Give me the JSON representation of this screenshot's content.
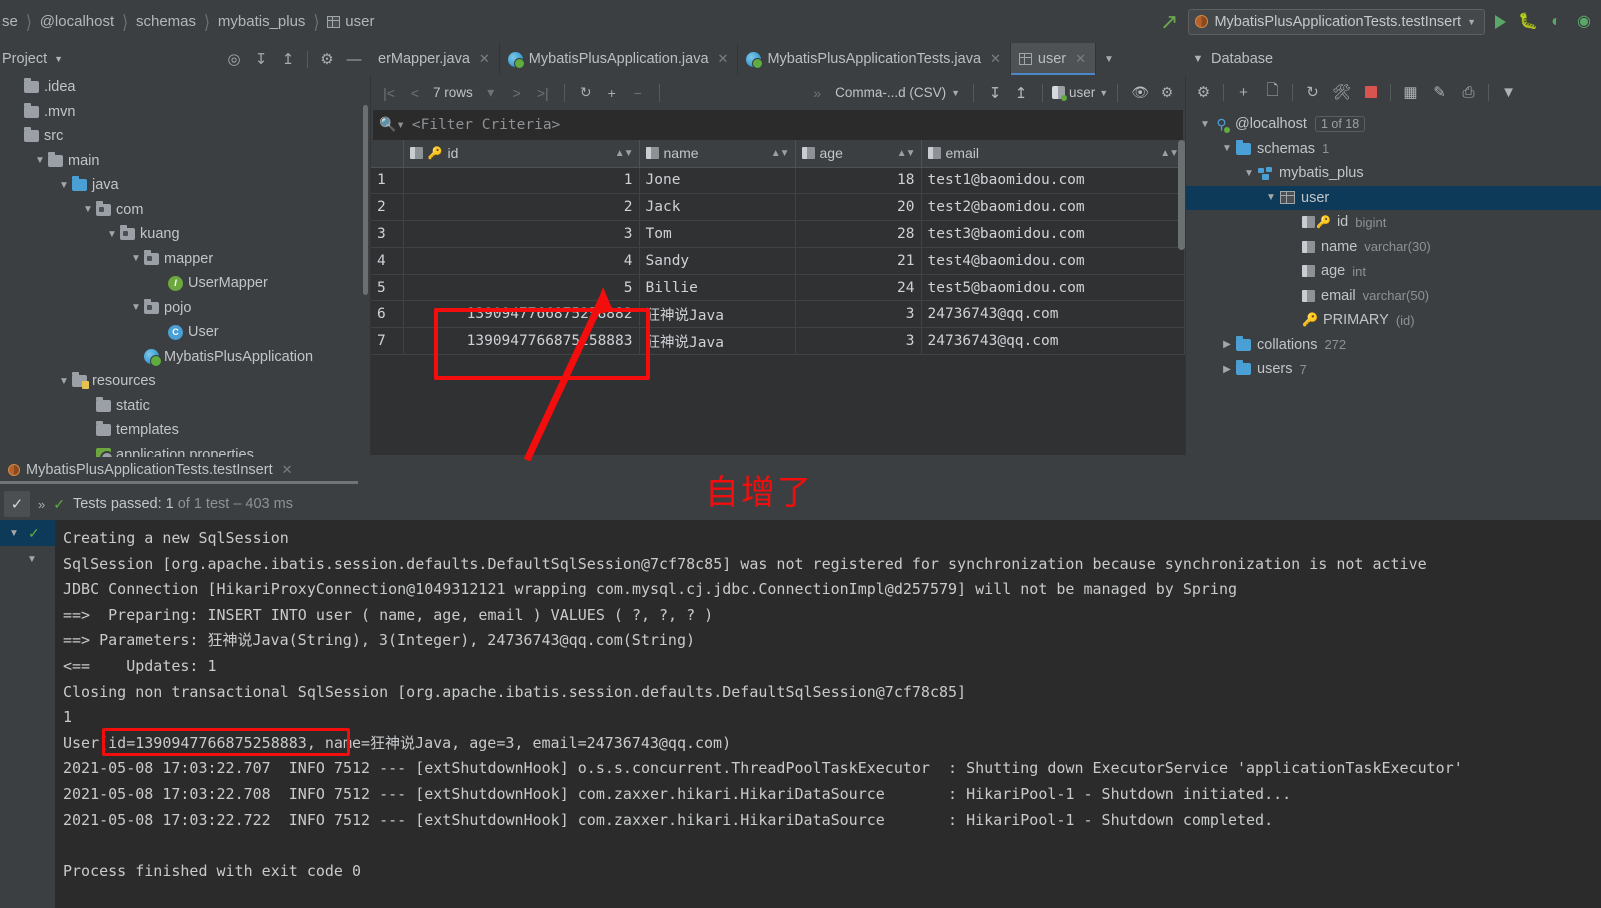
{
  "breadcrumb": {
    "items": [
      "@localhost",
      "schemas",
      "mybatis_plus",
      "user"
    ],
    "first_partial": "se"
  },
  "toolbar": {
    "run_config": "MybatisPlusApplicationTests.testInsert",
    "run_label": "Run",
    "debug_label": "Debug",
    "coverage_label": "Run with Coverage"
  },
  "project_tool": {
    "title": "Project"
  },
  "editor_tabs": [
    {
      "label": "erMapper.java",
      "icon": "java-file-icon",
      "active": false
    },
    {
      "label": "MybatisPlusApplication.java",
      "icon": "spring-boot-icon",
      "active": false
    },
    {
      "label": "MybatisPlusApplicationTests.java",
      "icon": "spring-boot-icon",
      "active": false
    },
    {
      "label": "user",
      "icon": "table-icon",
      "active": true
    }
  ],
  "project_tree": [
    {
      "label": ".idea",
      "indent": 0,
      "chevron": "",
      "icon": "folder"
    },
    {
      "label": ".mvn",
      "indent": 0,
      "chevron": "",
      "icon": "folder"
    },
    {
      "label": "src",
      "indent": 0,
      "chevron": "",
      "icon": "folder"
    },
    {
      "label": "main",
      "indent": 1,
      "chevron": "v",
      "icon": "folder"
    },
    {
      "label": "java",
      "indent": 2,
      "chevron": "v",
      "icon": "folder-blue"
    },
    {
      "label": "com",
      "indent": 3,
      "chevron": "v",
      "icon": "folder-pkg"
    },
    {
      "label": "kuang",
      "indent": 4,
      "chevron": "v",
      "icon": "folder-pkg"
    },
    {
      "label": "mapper",
      "indent": 5,
      "chevron": "v",
      "icon": "folder-pkg"
    },
    {
      "label": "UserMapper",
      "indent": 6,
      "chevron": "",
      "icon": "interface"
    },
    {
      "label": "pojo",
      "indent": 5,
      "chevron": "v",
      "icon": "folder-pkg"
    },
    {
      "label": "User",
      "indent": 6,
      "chevron": "",
      "icon": "class"
    },
    {
      "label": "MybatisPlusApplication",
      "indent": 5,
      "chevron": "",
      "icon": "spring-boot"
    },
    {
      "label": "resources",
      "indent": 2,
      "chevron": "v",
      "icon": "folder-res"
    },
    {
      "label": "static",
      "indent": 3,
      "chevron": "",
      "icon": "folder"
    },
    {
      "label": "templates",
      "indent": 3,
      "chevron": "",
      "icon": "folder"
    },
    {
      "label": "application.properties",
      "indent": 3,
      "chevron": "",
      "icon": "properties"
    }
  ],
  "grid_toolbar": {
    "rows_label": "7 rows",
    "format": "Comma-...d (CSV)",
    "schema_chip": "user",
    "first_page": "|<",
    "prev_page": "<",
    "next_page": ">",
    "last_page": ">|",
    "reload": "refresh-icon",
    "add_row": "+",
    "remove_row": "−",
    "expand": "»"
  },
  "filter": {
    "placeholder": "<Filter Criteria>"
  },
  "table": {
    "columns": [
      {
        "name": "id",
        "icon": "pk-column-icon"
      },
      {
        "name": "name",
        "icon": "column-icon"
      },
      {
        "name": "age",
        "icon": "column-icon"
      },
      {
        "name": "email",
        "icon": "column-icon"
      }
    ],
    "rows": [
      {
        "n": "1",
        "id": "1",
        "name": "Jone",
        "age": "18",
        "email": "test1@baomidou.com"
      },
      {
        "n": "2",
        "id": "2",
        "name": "Jack",
        "age": "20",
        "email": "test2@baomidou.com"
      },
      {
        "n": "3",
        "id": "3",
        "name": "Tom",
        "age": "28",
        "email": "test3@baomidou.com"
      },
      {
        "n": "4",
        "id": "4",
        "name": "Sandy",
        "age": "21",
        "email": "test4@baomidou.com"
      },
      {
        "n": "5",
        "id": "5",
        "name": "Billie",
        "age": "24",
        "email": "test5@baomidou.com"
      },
      {
        "n": "6",
        "id": "1390947766875258882",
        "name": "狂神说Java",
        "age": "3",
        "email": "24736743@qq.com"
      },
      {
        "n": "7",
        "id": "1390947766875258883",
        "name": "狂神说Java",
        "age": "3",
        "email": "24736743@qq.com"
      }
    ]
  },
  "database_panel": {
    "title": "Database",
    "tree": [
      {
        "label": "@localhost",
        "indent": 0,
        "chevron": "v",
        "icon": "connection",
        "badge": "1 of 18",
        "meta": "",
        "selected": false
      },
      {
        "label": "schemas",
        "indent": 1,
        "chevron": "v",
        "icon": "folder-blue",
        "badge": "",
        "meta": "1",
        "selected": false
      },
      {
        "label": "mybatis_plus",
        "indent": 2,
        "chevron": "v",
        "icon": "schema",
        "badge": "",
        "meta": "",
        "selected": false
      },
      {
        "label": "user",
        "indent": 3,
        "chevron": "v",
        "icon": "table",
        "badge": "",
        "meta": "",
        "selected": true
      },
      {
        "label": "id",
        "indent": 4,
        "chevron": "",
        "icon": "pk-column",
        "badge": "",
        "meta": "bigint",
        "selected": false
      },
      {
        "label": "name",
        "indent": 4,
        "chevron": "",
        "icon": "column",
        "badge": "",
        "meta": "varchar(30)",
        "selected": false
      },
      {
        "label": "age",
        "indent": 4,
        "chevron": "",
        "icon": "column",
        "badge": "",
        "meta": "int",
        "selected": false
      },
      {
        "label": "email",
        "indent": 4,
        "chevron": "",
        "icon": "column",
        "badge": "",
        "meta": "varchar(50)",
        "selected": false
      },
      {
        "label": "PRIMARY",
        "indent": 4,
        "chevron": "",
        "icon": "key",
        "badge": "",
        "meta": "(id)",
        "selected": false
      },
      {
        "label": "collations",
        "indent": 1,
        "chevron": ">",
        "icon": "folder-blue",
        "badge": "",
        "meta": "272",
        "selected": false
      },
      {
        "label": "users",
        "indent": 1,
        "chevron": ">",
        "icon": "folder-blue",
        "badge": "",
        "meta": "7",
        "selected": false
      }
    ]
  },
  "run_panel": {
    "tab_label": "MybatisPlusApplicationTests.testInsert",
    "status_prefix": "Tests passed: 1",
    "status_suffix": "of 1 test – 403 ms"
  },
  "console": {
    "lines": [
      "Creating a new SqlSession",
      "SqlSession [org.apache.ibatis.session.defaults.DefaultSqlSession@7cf78c85] was not registered for synchronization because synchronization is not active",
      "JDBC Connection [HikariProxyConnection@1049312121 wrapping com.mysql.cj.jdbc.ConnectionImpl@d257579] will not be managed by Spring",
      "==>  Preparing: INSERT INTO user ( name, age, email ) VALUES ( ?, ?, ? )",
      "==> Parameters: 狂神说Java(String), 3(Integer), 24736743@qq.com(String)",
      "<==    Updates: 1",
      "Closing non transactional SqlSession [org.apache.ibatis.session.defaults.DefaultSqlSession@7cf78c85]",
      "1",
      "User(id=1390947766875258883, name=狂神说Java, age=3, email=24736743@qq.com)",
      "2021-05-08 17:03:22.707  INFO 7512 --- [extShutdownHook] o.s.s.concurrent.ThreadPoolTaskExecutor  : Shutting down ExecutorService 'applicationTaskExecutor'",
      "2021-05-08 17:03:22.708  INFO 7512 --- [extShutdownHook] com.zaxxer.hikari.HikariDataSource       : HikariPool-1 - Shutdown initiated...",
      "2021-05-08 17:03:22.722  INFO 7512 --- [extShutdownHook] com.zaxxer.hikari.HikariDataSource       : HikariPool-1 - Shutdown completed.",
      "",
      "Process finished with exit code 0"
    ]
  },
  "annotations": {
    "note_text": "自增了",
    "color": "#f40d0d"
  }
}
